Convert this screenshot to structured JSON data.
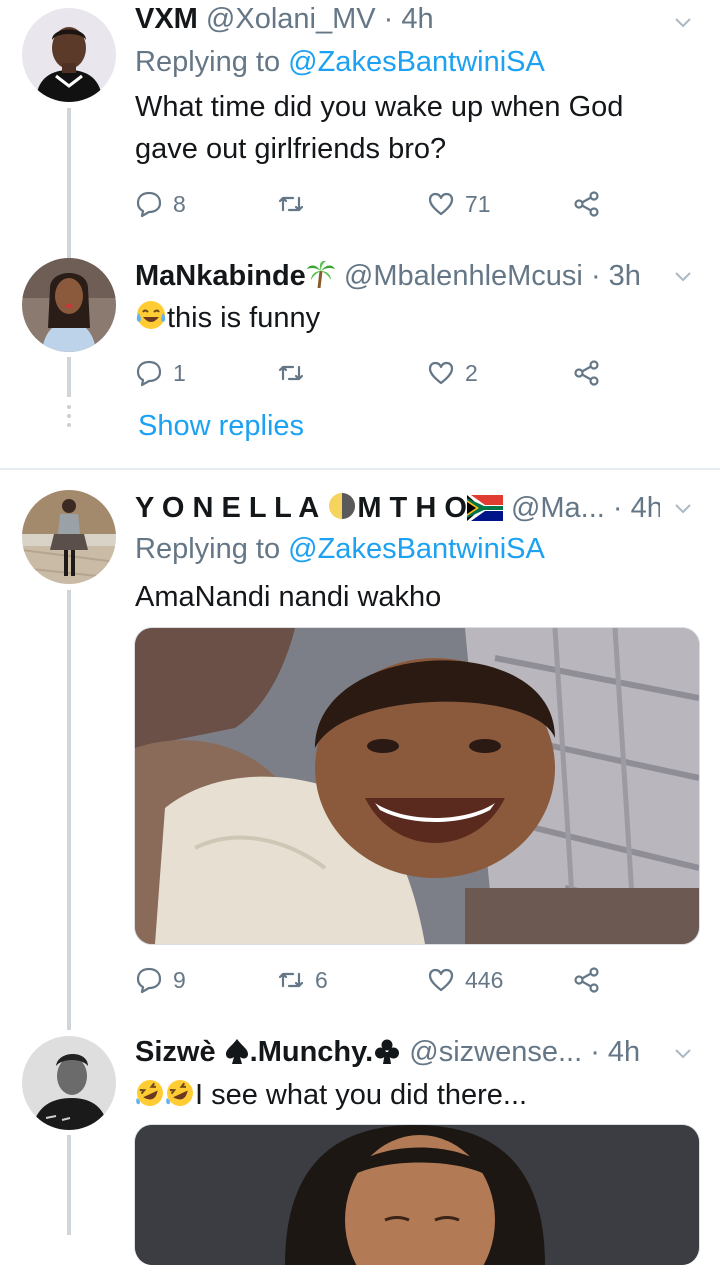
{
  "tweets": [
    {
      "name": "VXM",
      "handle": "@Xolani_MV",
      "time": "· 4h",
      "replying_prefix": "Replying to",
      "replying_to": "@ZakesBantwiniSA",
      "text_lines": [
        "What time did you wake up when God",
        "gave out girlfriends bro?"
      ],
      "replies": "8",
      "retweets": "",
      "likes": "71"
    },
    {
      "name": "MaNkabinde",
      "name_emoji": "palm-tree",
      "handle": "@MbalenhleMcusi",
      "time": "· 3h",
      "text": "this is funny",
      "text_emoji": "tears-of-joy",
      "replies": "1",
      "retweets": "",
      "likes": "2",
      "show_replies": "Show replies"
    },
    {
      "name_part1": "Y O N E L L A",
      "name_part2": "M T H O",
      "name_emojis": [
        "last-quarter-moon",
        "south-africa-flag"
      ],
      "handle": "@Ma...",
      "time": "· 4h",
      "replying_prefix": "Replying to",
      "replying_to": "@ZakesBantwiniSA",
      "text": "AmaNandi nandi wakho",
      "replies": "9",
      "retweets": "6",
      "likes": "446"
    },
    {
      "name_part1": "Sizwè",
      "name_part2": ".Munchy.",
      "name_emojis": [
        "spade",
        "club"
      ],
      "handle": "@sizwense...",
      "time": "· 4h",
      "text": "I see what you did there...",
      "text_emojis": [
        "rolling-on-floor-laughing",
        "rolling-on-floor-laughing"
      ]
    }
  ],
  "icons": {
    "reply": "speech-bubble-icon",
    "retweet": "retweet-icon",
    "like": "heart-icon",
    "share": "share-icon",
    "more": "chevron-down-icon"
  },
  "colors": {
    "link": "#1da1f2",
    "secondary_text": "#657786",
    "primary_text": "#14171a",
    "thread_line": "#d0d5d9"
  }
}
